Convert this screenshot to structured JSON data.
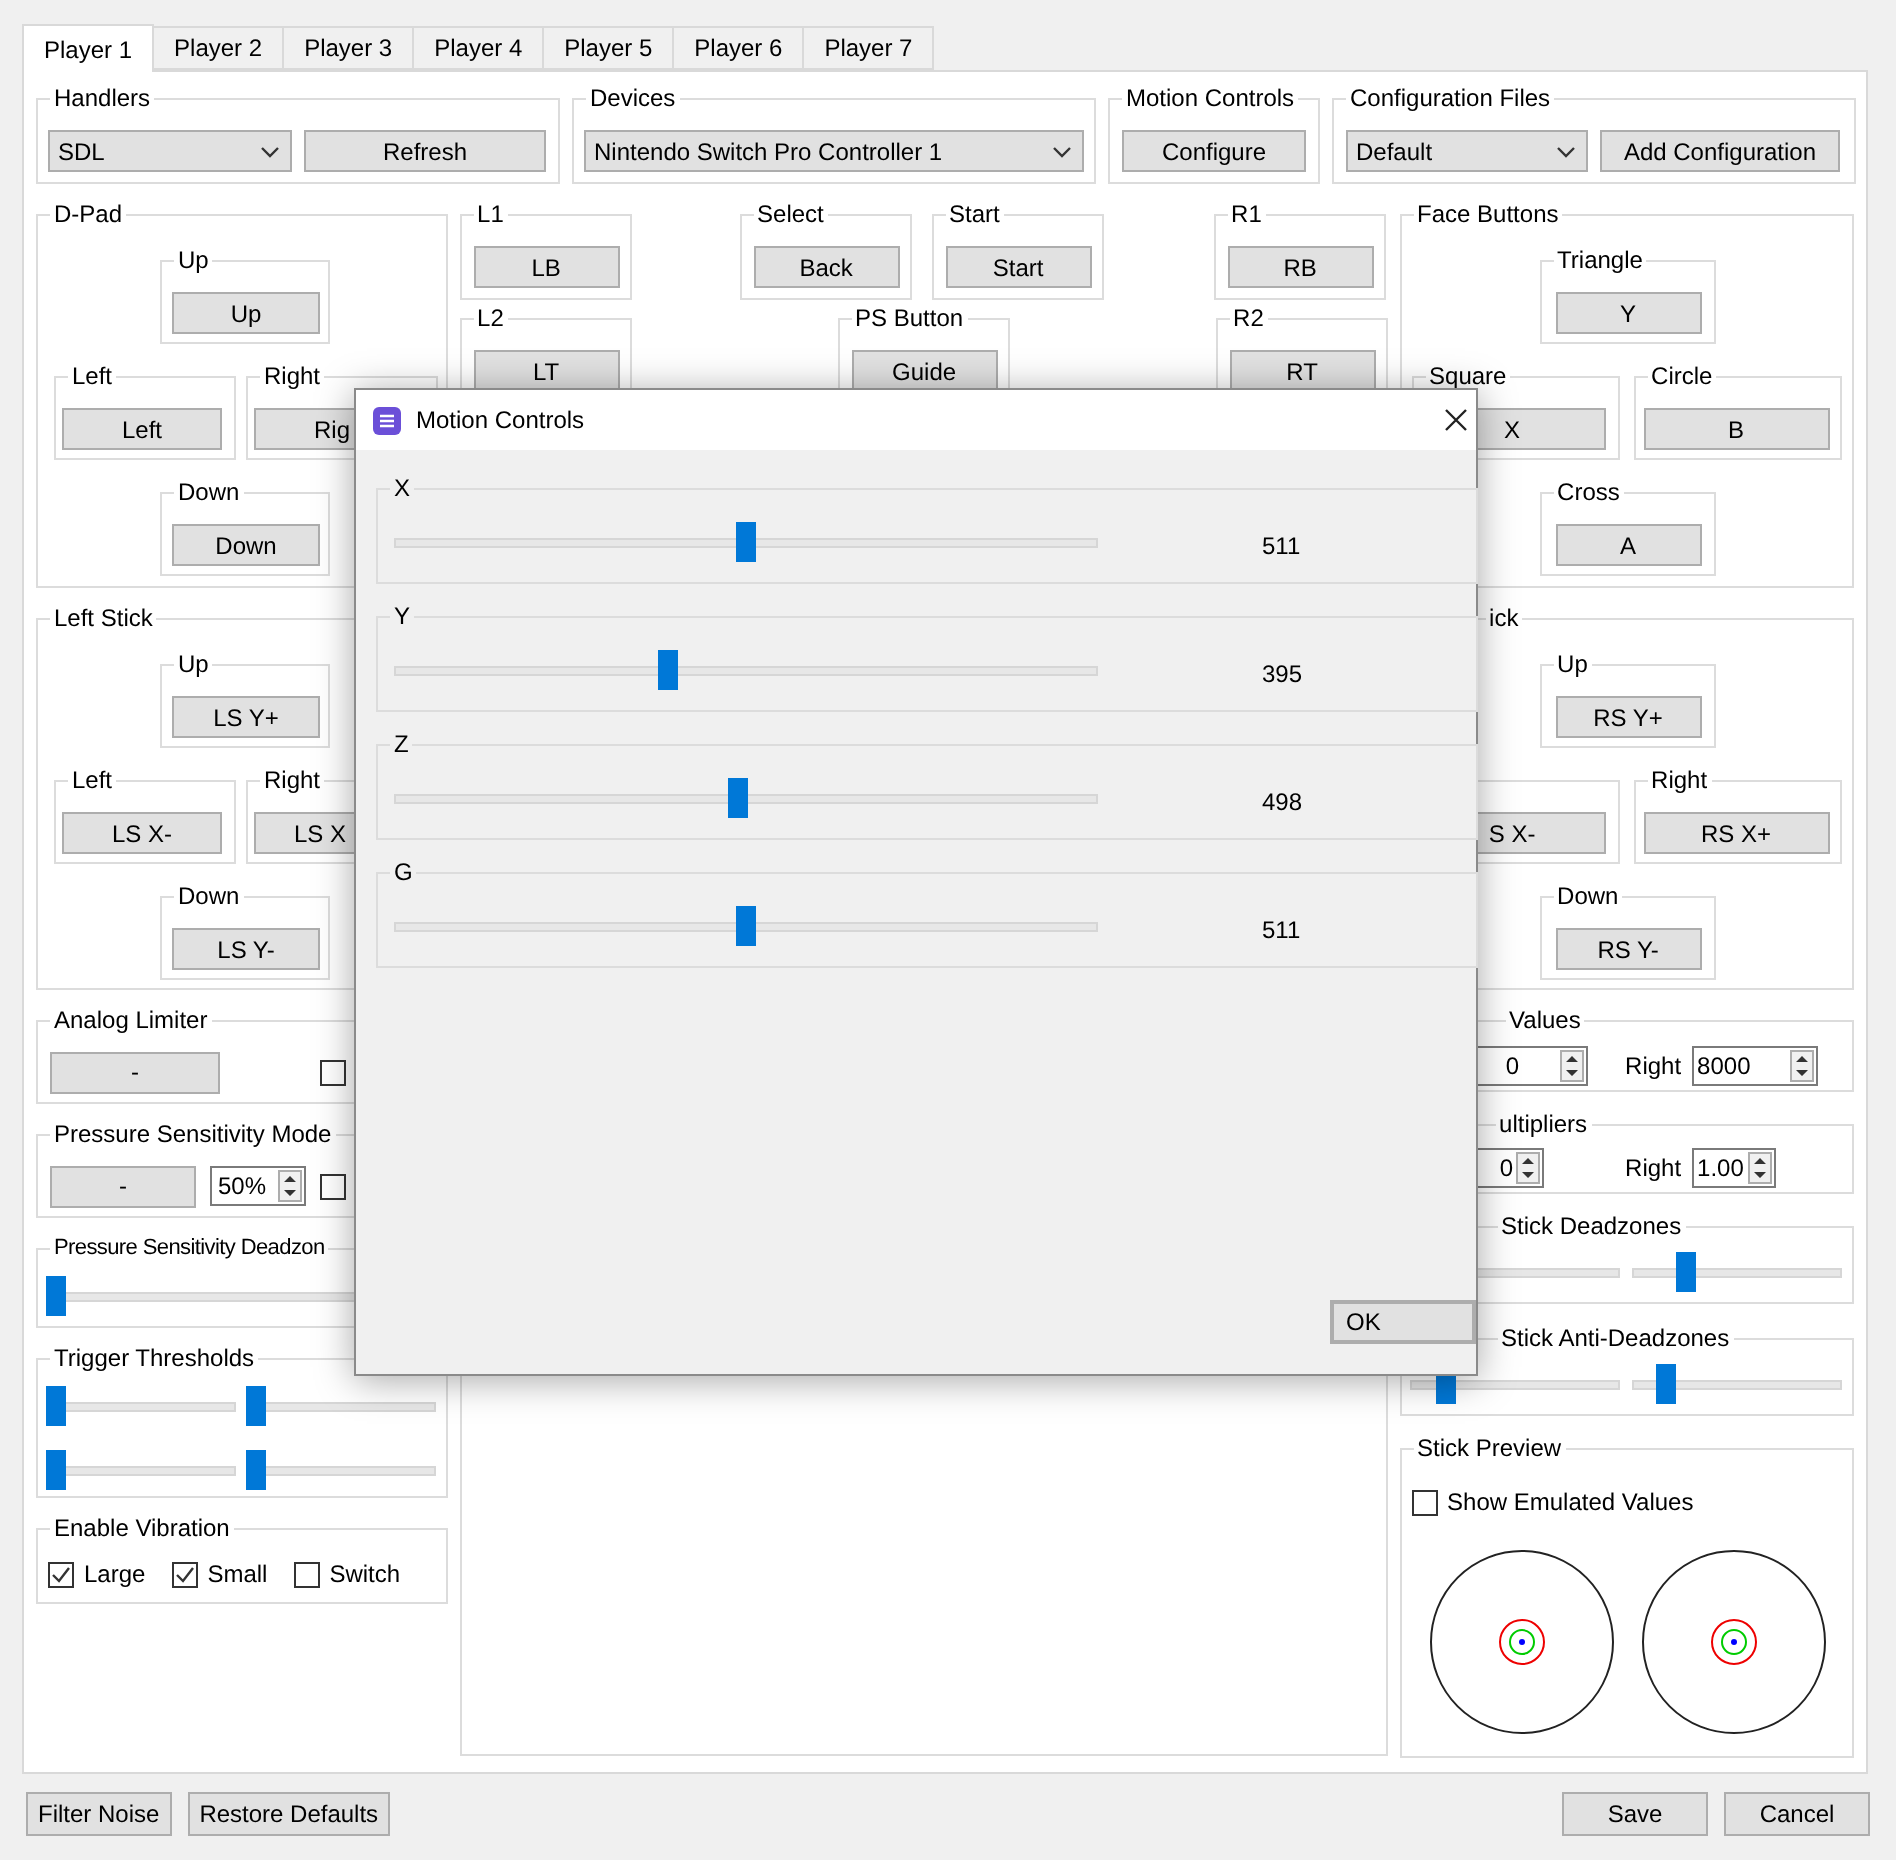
{
  "tabs": [
    {
      "label": "Player 1",
      "selected": true
    },
    {
      "label": "Player 2",
      "selected": false
    },
    {
      "label": "Player 3",
      "selected": false
    },
    {
      "label": "Player 4",
      "selected": false
    },
    {
      "label": "Player 5",
      "selected": false
    },
    {
      "label": "Player 6",
      "selected": false
    },
    {
      "label": "Player 7",
      "selected": false
    }
  ],
  "handlers": {
    "label": "Handlers",
    "dropdown": "SDL",
    "button": "Refresh"
  },
  "devices": {
    "label": "Devices",
    "dropdown": "Nintendo Switch Pro Controller 1"
  },
  "motion_controls": {
    "label": "Motion Controls",
    "button": "Configure"
  },
  "configuration_files": {
    "label": "Configuration Files",
    "dropdown": "Default",
    "button": "Add Configuration"
  },
  "dpad": {
    "label": "D-Pad",
    "up": {
      "label": "Up",
      "button": "Up"
    },
    "left": {
      "label": "Left",
      "button": "Left"
    },
    "right": {
      "label": "Right",
      "button": "Rig"
    },
    "down": {
      "label": "Down",
      "button": "Down"
    }
  },
  "left_stick": {
    "label": "Left Stick",
    "up": {
      "label": "Up",
      "button": "LS Y+"
    },
    "left": {
      "label": "Left",
      "button": "LS X-"
    },
    "right": {
      "label": "Right",
      "button": "LS X"
    },
    "down": {
      "label": "Down",
      "button": "LS Y-"
    }
  },
  "analog_limiter": {
    "label": "Analog Limiter",
    "button": "-",
    "checked": false
  },
  "pressure_sensitivity_mode": {
    "label": "Pressure Sensitivity Mode",
    "button": "-",
    "value": "50%",
    "checked": false
  },
  "pressure_sensitivity_deadzone": {
    "label": "Pressure Sensitivity Deadzon",
    "level": 0
  },
  "trigger_thresholds": {
    "label": "Trigger Thresholds",
    "sliders": [
      {
        "level": 0
      },
      {
        "level": 0
      },
      {
        "level": 0
      },
      {
        "level": 0
      }
    ]
  },
  "enable_vibration": {
    "label": "Enable Vibration",
    "options": [
      {
        "label": "Large",
        "checked": true
      },
      {
        "label": "Small",
        "checked": true
      },
      {
        "label": "Switch",
        "checked": false
      }
    ]
  },
  "l1": {
    "label": "L1",
    "button": "LB"
  },
  "select": {
    "label": "Select",
    "button": "Back"
  },
  "start": {
    "label": "Start",
    "button": "Start"
  },
  "r1": {
    "label": "R1",
    "button": "RB"
  },
  "l2": {
    "label": "L2",
    "button": "LT"
  },
  "ps_button": {
    "label": "PS Button",
    "button": "Guide"
  },
  "r2": {
    "label": "R2",
    "button": "RT"
  },
  "face_buttons": {
    "label": "Face Buttons",
    "up": {
      "label": "Triangle",
      "button": "Y"
    },
    "left": {
      "label": "Square",
      "button": "X"
    },
    "right": {
      "label": "Circle",
      "button": "B"
    },
    "down": {
      "label": "Cross",
      "button": "A"
    }
  },
  "right_stick": {
    "label": "ick",
    "up": {
      "label": "Up",
      "button": "RS Y+"
    },
    "left": {
      "button": "S X-"
    },
    "right": {
      "label": "Right",
      "button": "RS X+"
    },
    "down": {
      "label": "Down",
      "button": "RS Y-"
    }
  },
  "values": {
    "label": "Values",
    "left_value": "0",
    "right_label": "Right",
    "right_value": "8000"
  },
  "multipliers": {
    "label": "ultipliers",
    "left_value": "0",
    "right_label": "Right",
    "right_value": "1.00"
  },
  "stick_deadzones": {
    "label": "Stick Deadzones",
    "sliders": [
      {
        "kind": "track"
      },
      {
        "kind": "slider",
        "level": 0.24
      }
    ]
  },
  "stick_anti_deadzones": {
    "label": "Stick Anti-Deadzones",
    "sliders": [
      {
        "level": 0.14
      },
      {
        "level": 0.13
      }
    ]
  },
  "stick_preview": {
    "label": "Stick Preview",
    "checkbox": {
      "label": "Show Emulated Values",
      "checked": false
    }
  },
  "bottom_left_buttons": [
    "Filter Noise",
    "Restore Defaults"
  ],
  "bottom_right_buttons": [
    "Save",
    "Cancel"
  ],
  "dialog": {
    "title": "Motion Controls",
    "axes": [
      {
        "label": "X",
        "level": 0.4995,
        "reading": "511"
      },
      {
        "label": "Y",
        "level": 0.386,
        "reading": "395"
      },
      {
        "label": "Z",
        "level": 0.487,
        "reading": "498"
      },
      {
        "label": "G",
        "level": 0.4995,
        "reading": "511"
      }
    ],
    "button": "OK"
  }
}
